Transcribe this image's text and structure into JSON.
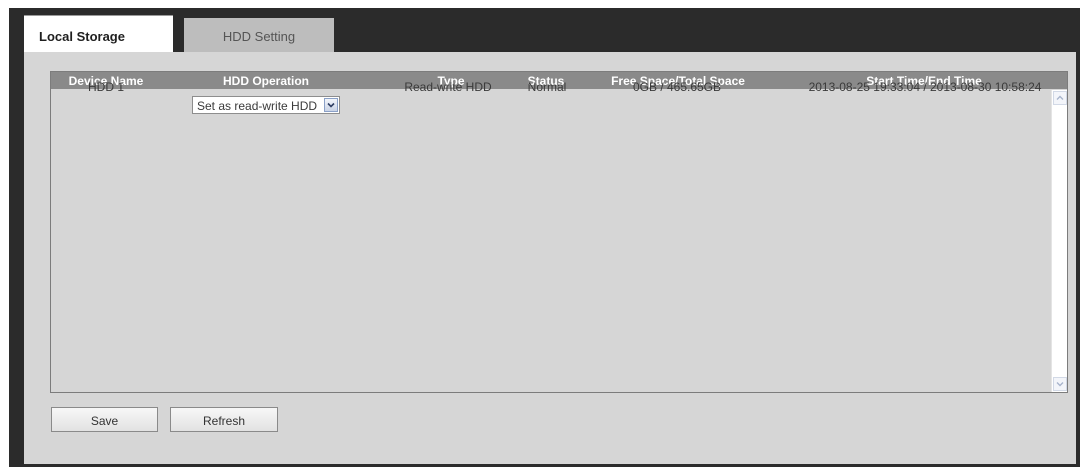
{
  "tabs": [
    {
      "label": "Local Storage",
      "active": true
    },
    {
      "label": "HDD Setting",
      "active": false
    }
  ],
  "table": {
    "columns": [
      "Device Name",
      "HDD Operation",
      "Type",
      "Status",
      "Free Space/Total Space",
      "Start Time/End Time"
    ],
    "rows": [
      {
        "device_name": "HDD 1",
        "hdd_operation": "Set as read-write HDD",
        "type": "Read-write HDD",
        "status": "Normal",
        "space": "0GB / 465.65GB",
        "time": "2013-08-25 19:33:04 / 2013-08-30 10:58:24"
      }
    ]
  },
  "buttons": {
    "save": "Save",
    "refresh": "Refresh"
  },
  "colors": {
    "window_bg": "#2b2b2b",
    "content_bg": "#d6d6d6",
    "header_bg": "#8a8a8a"
  },
  "icons": {
    "select_arrow": "chevron-down-icon",
    "scroll_up": "chevron-up-icon",
    "scroll_down": "chevron-down-icon"
  }
}
